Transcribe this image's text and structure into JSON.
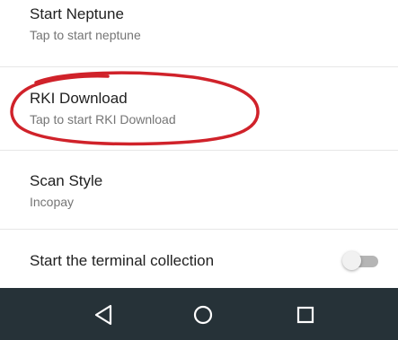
{
  "preferences": [
    {
      "title": "Start Neptune",
      "summary": "Tap to start neptune"
    },
    {
      "title": "RKI Download",
      "summary": "Tap to start RKI Download"
    },
    {
      "title": "Scan Style",
      "summary": "Incopay"
    }
  ],
  "collection": {
    "title": "Start the terminal collection",
    "toggle_on": false
  },
  "annotation": {
    "color": "#d0222a",
    "shape": "hand-drawn-ellipse"
  },
  "navbar": {
    "background": "#263238",
    "buttons": [
      {
        "icon": "back-triangle-icon"
      },
      {
        "icon": "home-circle-icon"
      },
      {
        "icon": "recents-square-icon"
      }
    ]
  }
}
